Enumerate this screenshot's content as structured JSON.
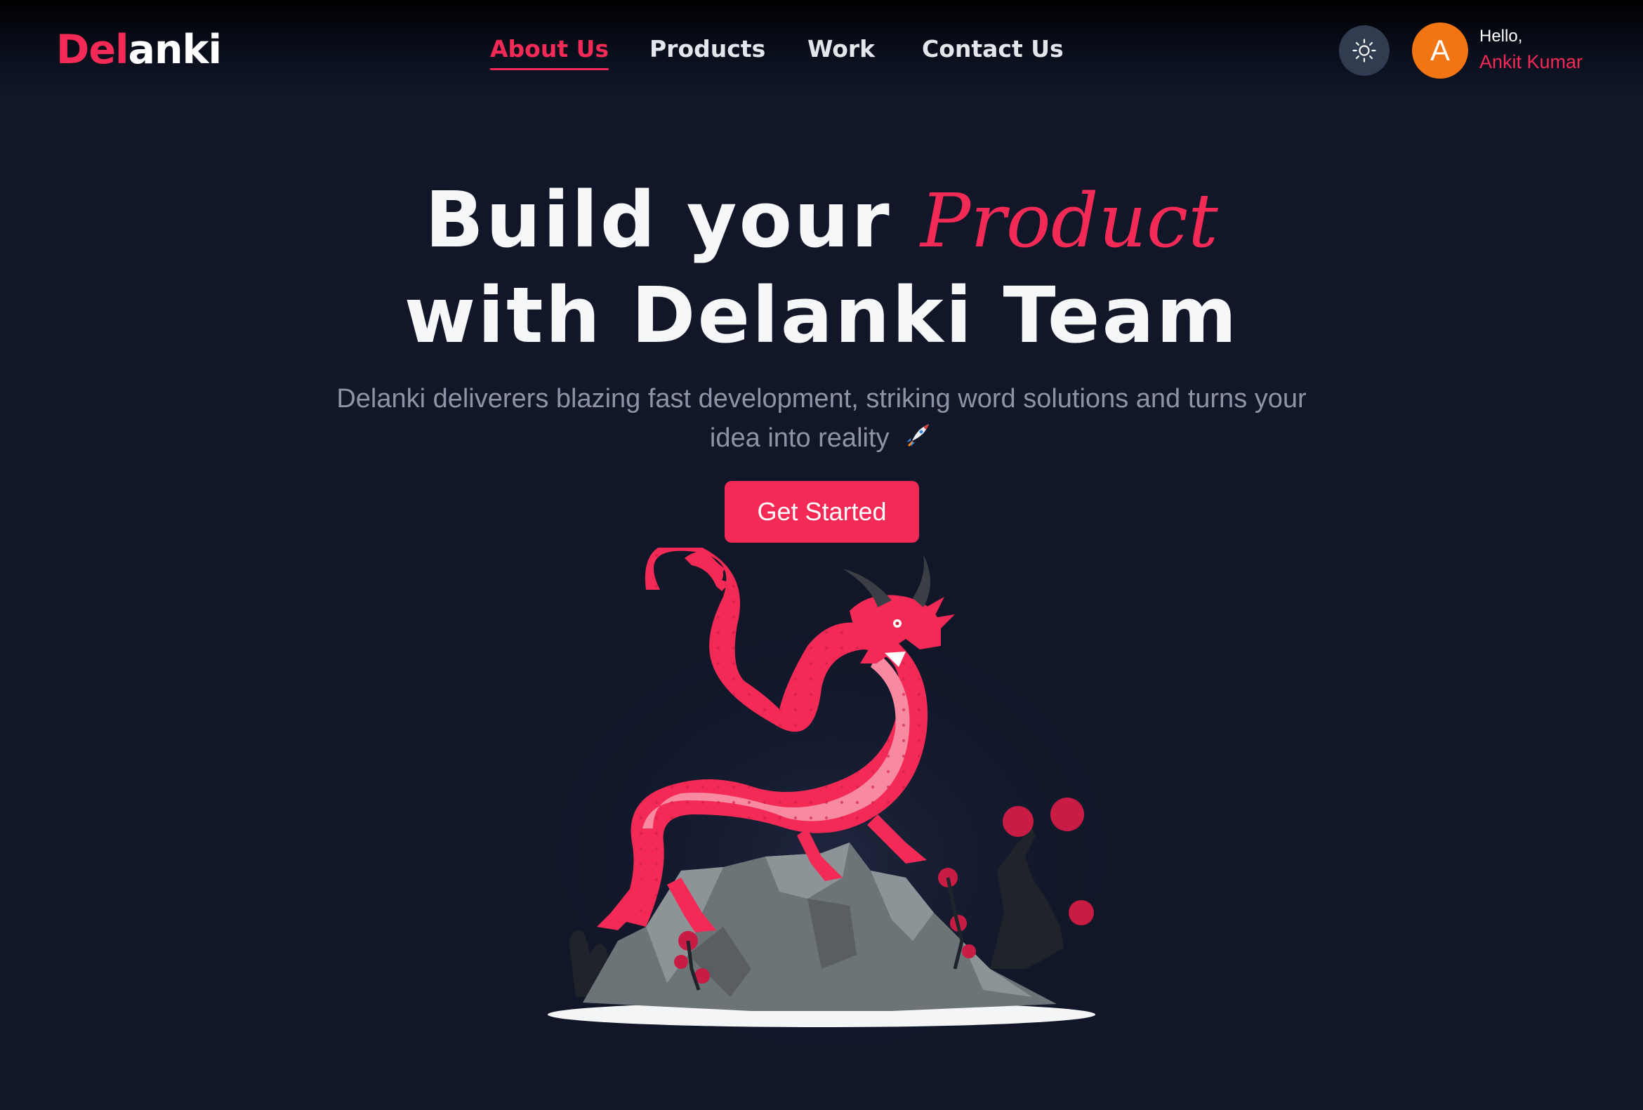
{
  "brand": {
    "logo_part1": "Del",
    "logo_part2": "anki"
  },
  "nav": {
    "items": [
      {
        "label": "About Us",
        "active": true
      },
      {
        "label": "Products",
        "active": false
      },
      {
        "label": "Work",
        "active": false
      },
      {
        "label": "Contact Us",
        "active": false
      }
    ]
  },
  "header_actions": {
    "theme_toggle_icon": "sun-icon",
    "avatar_initial": "A",
    "greeting": "Hello,",
    "user_name": "Ankit Kumar"
  },
  "hero": {
    "title_line1_prefix": "Build your",
    "title_line1_highlight": "Product",
    "title_line2": "with Delanki Team",
    "subtitle_line1": "Delanki deliverers blazing fast development, striking word solutions and turns your",
    "subtitle_line2": "idea into reality",
    "subtitle_emoji_icon": "rocket-icon",
    "cta_label": "Get Started",
    "illustration": "dragon-on-rock-illustration"
  },
  "colors": {
    "background": "#111729",
    "accent": "#f42a56",
    "avatar": "#f17512",
    "toggle_bg": "#313c50",
    "muted_text": "#8d94a6"
  }
}
